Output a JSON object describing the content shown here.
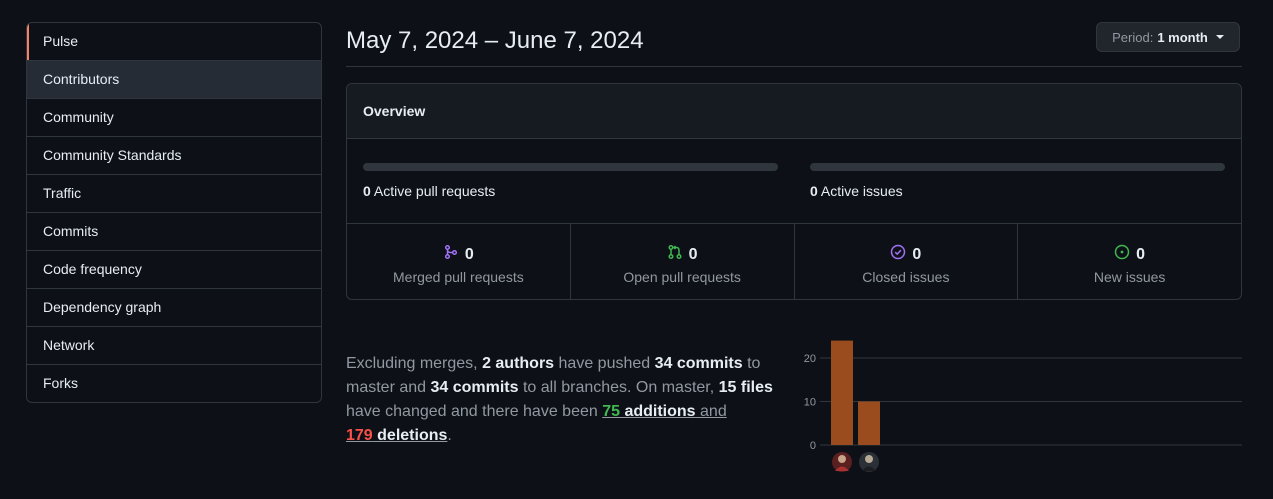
{
  "sidebar": {
    "items": [
      {
        "label": "Pulse"
      },
      {
        "label": "Contributors"
      },
      {
        "label": "Community"
      },
      {
        "label": "Community Standards"
      },
      {
        "label": "Traffic"
      },
      {
        "label": "Commits"
      },
      {
        "label": "Code frequency"
      },
      {
        "label": "Dependency graph"
      },
      {
        "label": "Network"
      },
      {
        "label": "Forks"
      }
    ],
    "selected": "Pulse",
    "hovered": "Contributors"
  },
  "header": {
    "date_range": "May 7, 2024 – June 7, 2024",
    "period_label": "Period:",
    "period_value": "1 month"
  },
  "overview": {
    "title": "Overview",
    "active_prs_count": "0",
    "active_prs_label": " Active pull requests",
    "active_issues_count": "0",
    "active_issues_label": " Active issues",
    "stats": [
      {
        "icon": "merged-pr-icon",
        "value": "0",
        "label": "Merged pull requests",
        "color": "#a371f7"
      },
      {
        "icon": "open-pr-icon",
        "value": "0",
        "label": "Open pull requests",
        "color": "#3fb950"
      },
      {
        "icon": "closed-issue-icon",
        "value": "0",
        "label": "Closed issues",
        "color": "#a371f7"
      },
      {
        "icon": "open-issue-icon",
        "value": "0",
        "label": "New issues",
        "color": "#3fb950"
      }
    ]
  },
  "summary": {
    "t1": "Excluding merges, ",
    "authors": "2 authors",
    "t2": " have pushed ",
    "commits1": "34 commits",
    "t3": " to master and ",
    "commits2": "34 commits",
    "t4": " to all branches. On master, ",
    "files": "15 files",
    "t5": " have changed and there have been ",
    "additions_num": "75",
    "additions_word": " additions",
    "t6": " and",
    "deletions_num": "179",
    "deletions_word": " deletions",
    "t7": "."
  },
  "chart_data": {
    "type": "bar",
    "categories": [
      "author-1",
      "author-2"
    ],
    "values": [
      24,
      10
    ],
    "ylim": [
      0,
      25
    ],
    "yticks": [
      0,
      10,
      20
    ],
    "bar_color": "#9b4c1e",
    "grid": true
  }
}
